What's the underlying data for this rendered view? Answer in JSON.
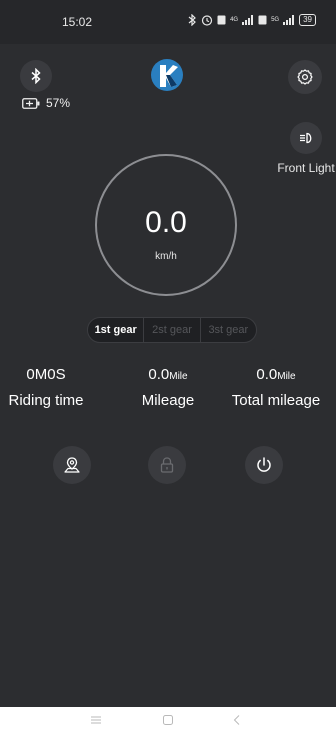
{
  "status_bar": {
    "time": "15:02",
    "battery": "39",
    "net_4g": "4G",
    "net_5g": "5G"
  },
  "battery": {
    "level": "57%"
  },
  "front_light": {
    "label": "Front Light"
  },
  "speed": {
    "value": "0.0",
    "unit": "km/h"
  },
  "gears": [
    {
      "label": "1st gear",
      "active": true
    },
    {
      "label": "2st gear",
      "active": false
    },
    {
      "label": "3st gear",
      "active": false
    }
  ],
  "stats": {
    "riding_time": {
      "value": "0M0S",
      "label": "Riding time"
    },
    "mileage": {
      "value": "0.0",
      "unit": "Mile",
      "label": "Mileage"
    },
    "total_mileage": {
      "value": "0.0",
      "unit": "Mile",
      "label": "Total mileage"
    }
  },
  "colors": {
    "background": "#2c2d30",
    "button": "#3a3b3f",
    "logo": "#2a7fc0",
    "ring": "#8d8e92"
  }
}
